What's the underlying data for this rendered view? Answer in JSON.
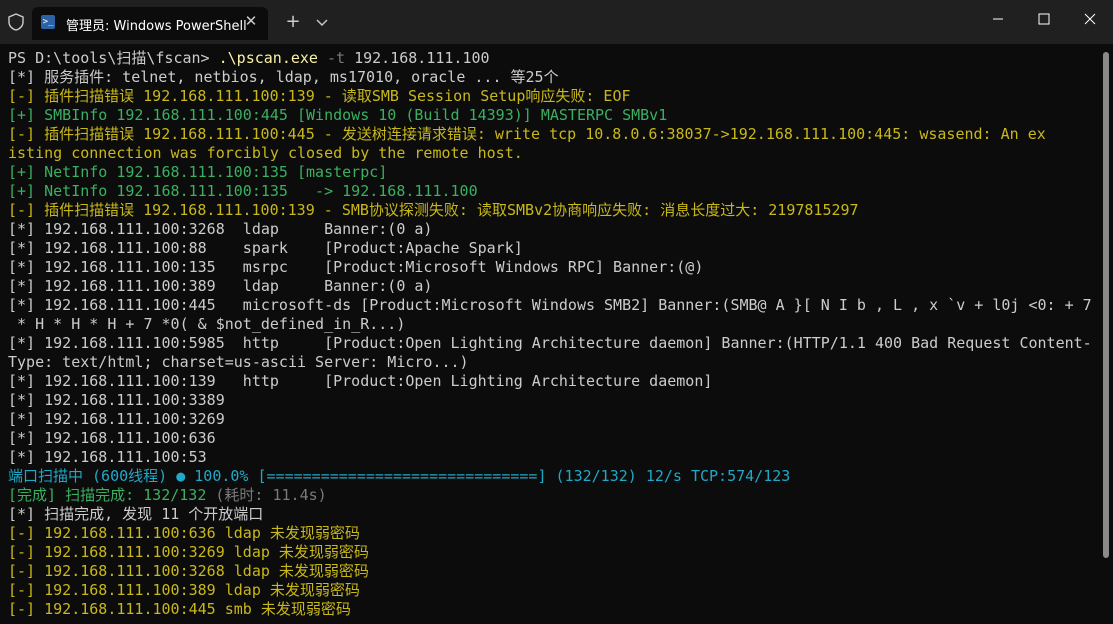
{
  "window": {
    "tab_title": "管理员: Windows PowerShell",
    "close_tab": "✕",
    "new_tab": "+"
  },
  "terminal": {
    "lines": [
      {
        "class": "white",
        "segments": [
          {
            "t": "PS D:\\tools\\扫描\\fscan> ",
            "c": "white"
          },
          {
            "t": ".\\pscan.exe",
            "c": "yellow"
          },
          {
            "t": " -t ",
            "c": "gray"
          },
          {
            "t": "192.168.111.100",
            "c": "white"
          }
        ]
      },
      {
        "class": "white",
        "segments": [
          {
            "t": "[*] 服务插件: telnet, netbios, ldap, ms17010, oracle ... 等25个",
            "c": "white"
          }
        ]
      },
      {
        "class": "yellow",
        "segments": [
          {
            "t": "[-] 插件扫描错误 192.168.111.100:139 - 读取SMB Session Setup响应失败: EOF",
            "c": "yellow2"
          }
        ]
      },
      {
        "class": "green",
        "segments": [
          {
            "t": "[+] SMBInfo 192.168.111.100:445 [Windows 10 (Build 14393)] MASTERPC SMBv1",
            "c": "green2"
          }
        ]
      },
      {
        "class": "yellow",
        "segments": [
          {
            "t": "[-] 插件扫描错误 192.168.111.100:445 - 发送树连接请求错误: write tcp 10.8.0.6:38037->192.168.111.100:445: wsasend: An ex",
            "c": "yellow2"
          }
        ]
      },
      {
        "class": "yellow",
        "segments": [
          {
            "t": "isting connection was forcibly closed by the remote host.",
            "c": "yellow2"
          }
        ]
      },
      {
        "class": "green",
        "segments": [
          {
            "t": "[+] NetInfo 192.168.111.100:135 [masterpc]",
            "c": "green2"
          }
        ]
      },
      {
        "class": "green",
        "segments": [
          {
            "t": "[+] NetInfo 192.168.111.100:135   -> 192.168.111.100",
            "c": "green2"
          }
        ]
      },
      {
        "class": "yellow",
        "segments": [
          {
            "t": "[-] 插件扫描错误 192.168.111.100:139 - SMB协议探测失败: 读取SMBv2协商响应失败: 消息长度过大: 2197815297",
            "c": "yellow2"
          }
        ]
      },
      {
        "class": "white",
        "segments": [
          {
            "t": "[*] 192.168.111.100:3268  ldap     Banner:(0 a)",
            "c": "white"
          }
        ]
      },
      {
        "class": "white",
        "segments": [
          {
            "t": "[*] 192.168.111.100:88    spark    [Product:Apache Spark]",
            "c": "white"
          }
        ]
      },
      {
        "class": "white",
        "segments": [
          {
            "t": "[*] 192.168.111.100:135   msrpc    [Product:Microsoft Windows RPC] Banner:(@)",
            "c": "white"
          }
        ]
      },
      {
        "class": "white",
        "segments": [
          {
            "t": "[*] 192.168.111.100:389   ldap     Banner:(0 a)",
            "c": "white"
          }
        ]
      },
      {
        "class": "white",
        "segments": [
          {
            "t": "[*] 192.168.111.100:445   microsoft-ds [Product:Microsoft Windows SMB2] Banner:(SMB@ A }[ N I b , L , x `v + l0j <0: + 7",
            "c": "white"
          }
        ]
      },
      {
        "class": "white",
        "segments": [
          {
            "t": " * H * H * H + 7 *0( & $not_defined_in_R...)",
            "c": "white"
          }
        ]
      },
      {
        "class": "white",
        "segments": [
          {
            "t": "[*] 192.168.111.100:5985  http     [Product:Open Lighting Architecture daemon] Banner:(HTTP/1.1 400 Bad Request Content-",
            "c": "white"
          }
        ]
      },
      {
        "class": "white",
        "segments": [
          {
            "t": "Type: text/html; charset=us-ascii Server: Micro...)",
            "c": "white"
          }
        ]
      },
      {
        "class": "white",
        "segments": [
          {
            "t": "[*] 192.168.111.100:139   http     [Product:Open Lighting Architecture daemon]",
            "c": "white"
          }
        ]
      },
      {
        "class": "white",
        "segments": [
          {
            "t": "[*] 192.168.111.100:3389",
            "c": "white"
          }
        ]
      },
      {
        "class": "white",
        "segments": [
          {
            "t": "[*] 192.168.111.100:3269",
            "c": "white"
          }
        ]
      },
      {
        "class": "white",
        "segments": [
          {
            "t": "[*] 192.168.111.100:636",
            "c": "white"
          }
        ]
      },
      {
        "class": "white",
        "segments": [
          {
            "t": "[*] 192.168.111.100:53",
            "c": "white"
          }
        ]
      },
      {
        "class": "cyan",
        "segments": [
          {
            "t": "端口扫描中 (600线程) ● 100.0% [==============================] (132/132) 12/s TCP:574/123",
            "c": "cyan"
          }
        ]
      },
      {
        "class": "green",
        "segments": [
          {
            "t": "[完成] 扫描完成: 132/132 ",
            "c": "green2"
          },
          {
            "t": "(耗时: 11.4s)",
            "c": "gray"
          }
        ]
      },
      {
        "class": "white",
        "segments": [
          {
            "t": "[*] 扫描完成, 发现 11 个开放端口",
            "c": "white"
          }
        ]
      },
      {
        "class": "yellow",
        "segments": [
          {
            "t": "[-] 192.168.111.100:636 ldap 未发现弱密码",
            "c": "yellow2"
          }
        ]
      },
      {
        "class": "yellow",
        "segments": [
          {
            "t": "[-] 192.168.111.100:3269 ldap 未发现弱密码",
            "c": "yellow2"
          }
        ]
      },
      {
        "class": "yellow",
        "segments": [
          {
            "t": "[-] 192.168.111.100:3268 ldap 未发现弱密码",
            "c": "yellow2"
          }
        ]
      },
      {
        "class": "yellow",
        "segments": [
          {
            "t": "[-] 192.168.111.100:389 ldap 未发现弱密码",
            "c": "yellow2"
          }
        ]
      },
      {
        "class": "yellow",
        "segments": [
          {
            "t": "[-] 192.168.111.100:445 smb 未发现弱密码",
            "c": "yellow2"
          }
        ]
      }
    ]
  }
}
